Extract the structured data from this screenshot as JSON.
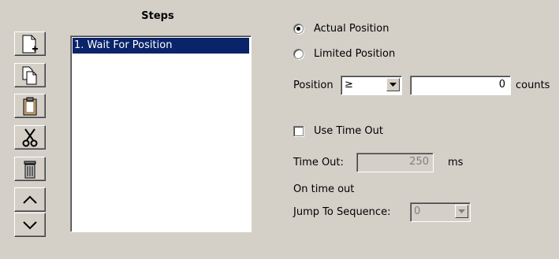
{
  "steps": {
    "title": "Steps",
    "items": [
      {
        "label": "1. Wait For Position",
        "selected": true
      }
    ]
  },
  "toolbar": {
    "buttons": [
      {
        "name": "new-step",
        "icon": "new-document-icon"
      },
      {
        "name": "copy-step",
        "icon": "copy-icon"
      },
      {
        "name": "paste-step",
        "icon": "paste-icon"
      },
      {
        "name": "cut-step",
        "icon": "scissors-icon"
      },
      {
        "name": "delete-step",
        "icon": "trash-icon"
      },
      {
        "name": "move-up",
        "icon": "chevron-up-icon"
      },
      {
        "name": "move-down",
        "icon": "chevron-down-icon"
      }
    ]
  },
  "position_mode": {
    "actual_label": "Actual Position",
    "limited_label": "Limited Position",
    "selected": "actual"
  },
  "position": {
    "label": "Position",
    "operator": "≥",
    "value": "0",
    "unit": "counts"
  },
  "timeout": {
    "use_label": "Use Time Out",
    "use_checked": false,
    "label": "Time Out:",
    "value": "250",
    "unit": "ms",
    "on_timeout_label": "On time out",
    "jump_label": "Jump To Sequence:",
    "jump_value": "0"
  },
  "colors": {
    "background": "#d4d0c8",
    "selection": "#0a246a"
  }
}
